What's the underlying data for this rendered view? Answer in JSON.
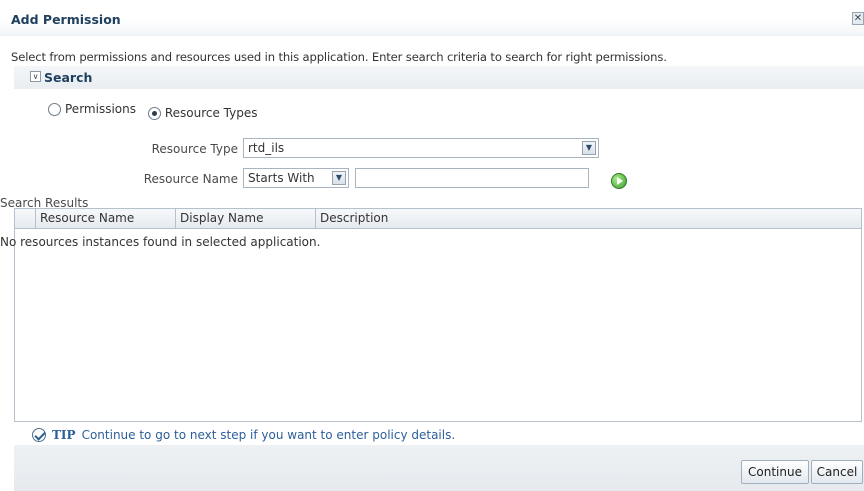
{
  "dialog": {
    "title": "Add Permission",
    "close_icon": "close-icon",
    "instructions": "Select from permissions and resources used in this application. Enter search criteria to search for right permissions."
  },
  "search": {
    "title": "Search",
    "radio_options": [
      {
        "label": "Permissions",
        "selected": false
      },
      {
        "label": "Resource Types",
        "selected": true
      }
    ],
    "resource_type_label": "Resource Type",
    "resource_type_value": "rtd_ils",
    "resource_name_label": "Resource Name",
    "match_operator_value": "Starts With",
    "resource_name_value": ""
  },
  "results": {
    "label": "Search Results",
    "columns": [
      "Resource Name",
      "Display Name",
      "Description"
    ],
    "empty_message": "No resources instances found in selected application."
  },
  "tip": {
    "label": "TIP",
    "text": "Continue to go to next step if you want to enter policy details."
  },
  "buttons": {
    "continue_label": "Continue",
    "cancel_label": "Cancel"
  },
  "colors": {
    "title": "#1e3f5e",
    "tip": "#2d5f9a",
    "border": "#b7c1cb"
  }
}
